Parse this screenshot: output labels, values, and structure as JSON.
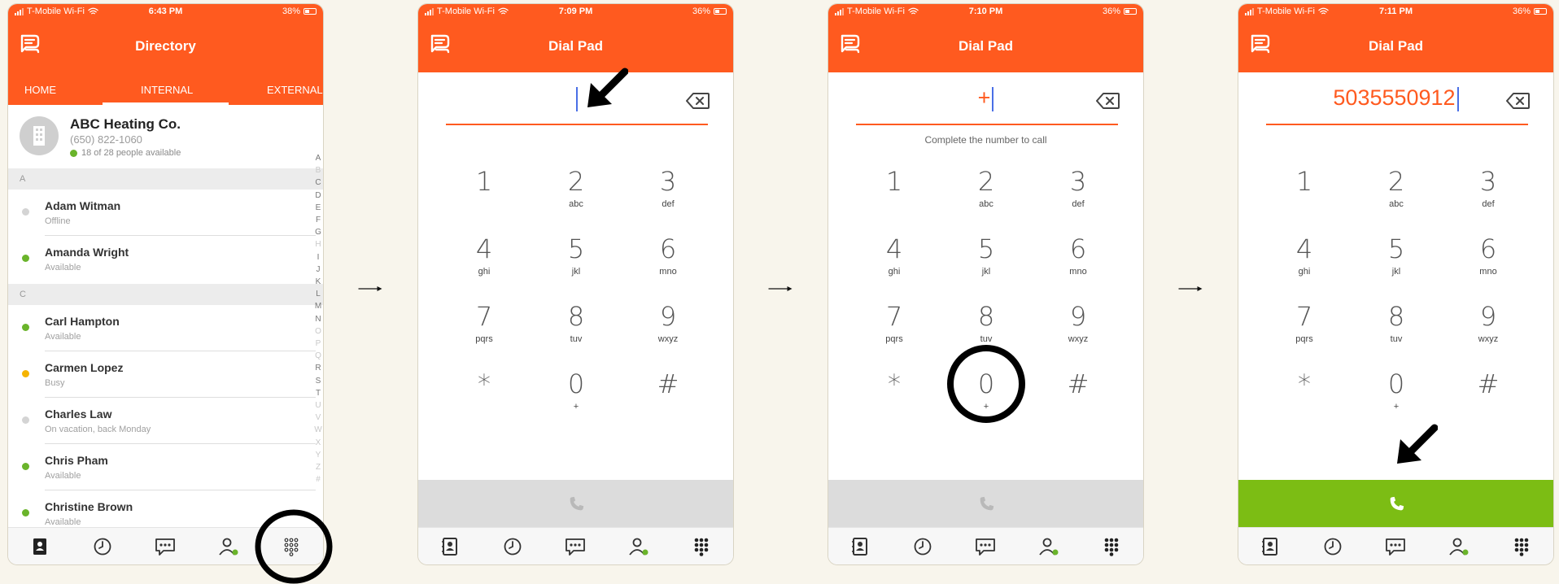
{
  "colors": {
    "brand": "#ff5a1f",
    "available": "#6ab42b",
    "busy": "#f5b400",
    "offline": "#d4d4d4",
    "call_active": "#7cbd14",
    "call_disabled": "#dcdcdc"
  },
  "screens": [
    {
      "status": {
        "carrier": "T-Mobile Wi-Fi",
        "time": "6:43 PM",
        "battery": "38%"
      },
      "title": "Directory",
      "tabs": [
        "HOME",
        "INTERNAL",
        "EXTERNAL"
      ],
      "selected_tab": "INTERNAL",
      "company": {
        "name": "ABC Heating Co.",
        "phone": "(650) 822-1060",
        "availability": "18 of 28 people available"
      },
      "sections": [
        {
          "letter": "A",
          "contacts": [
            {
              "name": "Adam Witman",
              "status": "Offline",
              "state": "offline"
            },
            {
              "name": "Amanda Wright",
              "status": "Available",
              "state": "available"
            }
          ]
        },
        {
          "letter": "C",
          "contacts": [
            {
              "name": "Carl Hampton",
              "status": "Available",
              "state": "available"
            },
            {
              "name": "Carmen Lopez",
              "status": "Busy",
              "state": "busy"
            },
            {
              "name": "Charles Law",
              "status": "On vacation, back Monday",
              "state": "offline"
            },
            {
              "name": "Chris Pham",
              "status": "Available",
              "state": "available"
            },
            {
              "name": "Christine Brown",
              "status": "Available",
              "state": "available"
            }
          ]
        }
      ],
      "index_letters": [
        "A",
        "B",
        "C",
        "D",
        "E",
        "F",
        "G",
        "H",
        "I",
        "J",
        "K",
        "L",
        "M",
        "N",
        "O",
        "P",
        "Q",
        "R",
        "S",
        "T",
        "U",
        "V",
        "W",
        "X",
        "Y",
        "Z",
        "#"
      ],
      "index_active": [
        "A",
        "C",
        "D",
        "E",
        "F",
        "G",
        "I",
        "J",
        "K",
        "L",
        "M",
        "N",
        "R",
        "S",
        "T"
      ],
      "bottom_nav": [
        "directory-icon",
        "recents-clock-icon",
        "messages-icon",
        "presence-person-icon",
        "dialpad-icon"
      ],
      "active_nav": "directory-icon",
      "annotation": "circle on dialpad-icon"
    },
    {
      "status": {
        "carrier": "T-Mobile Wi-Fi",
        "time": "7:09 PM",
        "battery": "36%"
      },
      "title": "Dial Pad",
      "entry": "",
      "hint": "",
      "call_enabled": false,
      "active_nav": "dialpad-icon",
      "annotation": "arrow pointing to number entry field"
    },
    {
      "status": {
        "carrier": "T-Mobile Wi-Fi",
        "time": "7:10 PM",
        "battery": "36%"
      },
      "title": "Dial Pad",
      "entry": "+",
      "hint": "Complete the number to call",
      "call_enabled": false,
      "active_nav": "dialpad-icon",
      "annotation": "circle on key 0"
    },
    {
      "status": {
        "carrier": "T-Mobile Wi-Fi",
        "time": "7:11 PM",
        "battery": "36%"
      },
      "title": "Dial Pad",
      "entry": "5035550912",
      "hint": "",
      "call_enabled": true,
      "active_nav": "dialpad-icon",
      "annotation": "arrow pointing to call button"
    }
  ],
  "keypad": [
    {
      "digit": "1",
      "letters": ""
    },
    {
      "digit": "2",
      "letters": "abc"
    },
    {
      "digit": "3",
      "letters": "def"
    },
    {
      "digit": "4",
      "letters": "ghi"
    },
    {
      "digit": "5",
      "letters": "jkl"
    },
    {
      "digit": "6",
      "letters": "mno"
    },
    {
      "digit": "7",
      "letters": "pqrs"
    },
    {
      "digit": "8",
      "letters": "tuv"
    },
    {
      "digit": "9",
      "letters": "wxyz"
    },
    {
      "digit": "*",
      "letters": ""
    },
    {
      "digit": "0",
      "letters": "+"
    },
    {
      "digit": "#",
      "letters": ""
    }
  ]
}
